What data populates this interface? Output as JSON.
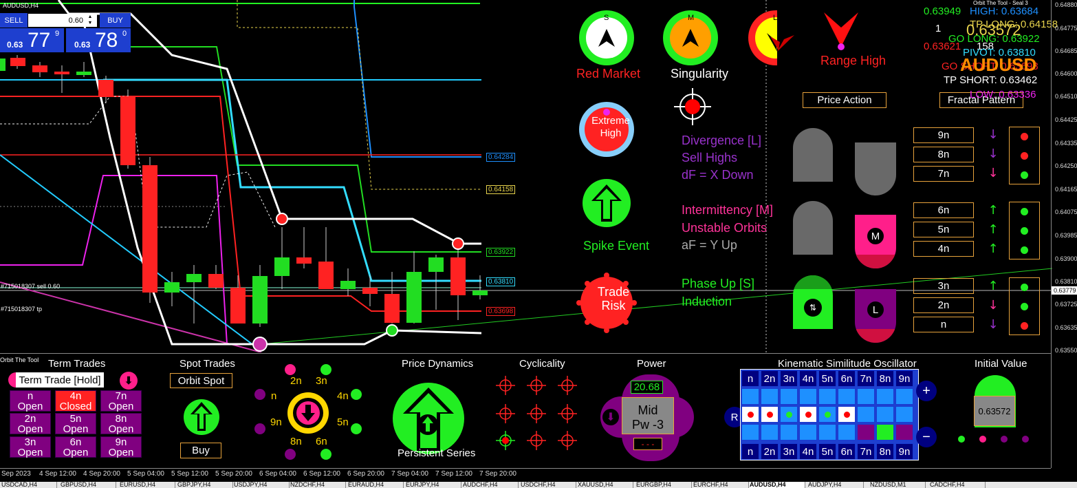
{
  "chart": {
    "symbol_tf": "AUDUSD,H4",
    "symbol_big": "AUDUSD",
    "orbit_label": "Orbit The Tool - Seal 3",
    "trade_label_sell": "#715018307 sell 0.60",
    "trade_label_tp": "#715018307 tp",
    "price_axis": [
      "0.64880",
      "0.64775",
      "0.64685",
      "0.64600",
      "0.64510",
      "0.64425",
      "0.64335",
      "0.64250",
      "0.64165",
      "0.64075",
      "0.63985",
      "0.63900",
      "0.63810",
      "0.63725",
      "0.63635",
      "0.63550"
    ],
    "current_price": "0.63779",
    "time_axis": [
      "Sep 2023",
      "4 Sep 12:00",
      "4 Sep 20:00",
      "5 Sep 04:00",
      "5 Sep 12:00",
      "5 Sep 20:00",
      "6 Sep 04:00",
      "6 Sep 12:00",
      "6 Sep 20:00",
      "7 Sep 04:00",
      "7 Sep 12:00",
      "7 Sep 20:00"
    ],
    "level_tags": {
      "l1": "0.64284",
      "l2": "0.64158",
      "l3": "0.63922",
      "l4": "0.63810",
      "l5": "0.63698"
    }
  },
  "trade_panel": {
    "sell_label": "SELL",
    "buy_label": "BUY",
    "lot_value": "0.60",
    "sell_prefix": "0.63",
    "sell_big": "77",
    "sell_sup": "9",
    "buy_prefix": "0.63",
    "buy_big": "78",
    "buy_sup": "0"
  },
  "info": {
    "v1": "0.63949",
    "high": "HIGH: 0.63684",
    "tp_long": "TP LONG: 0.64158",
    "one": "1",
    "big_price": "0.63572",
    "go_long": "GO LONG: 0.63922",
    "v2": "0.63621",
    "n158": "158",
    "pivot": "PIVOT: 0.63810",
    "go_short": "GO SHORT: 0.63698",
    "tp_short": "TP SHORT: 0.63462",
    "low": "LOW: 0.63336"
  },
  "indicators": {
    "red_market": "Red Market",
    "singularity": "Singularity",
    "range_high": "Range High",
    "s_letter": "S",
    "m_letter": "M",
    "l_letter": "L",
    "extreme_high": "Extreme High",
    "spike_event": "Spike Event",
    "trade_risk": "Trade Risk",
    "price_action": "Price Action",
    "fractal_pattern": "Fractal Pattern",
    "div1": "Divergence [L]",
    "div2": "Sell Highs",
    "div3": "dF = X Down",
    "int1": "Intermittency [M]",
    "int2": "Unstable Orbits",
    "int3": "aF = Y Up",
    "ph1": "Phase Up [S]",
    "ph2": "Induction",
    "m_icon": "M",
    "l_icon": "L",
    "nlabels": [
      "9n",
      "8n",
      "7n",
      "6n",
      "5n",
      "4n",
      "3n",
      "2n",
      "n"
    ]
  },
  "bottom": {
    "orbit_tool": "Orbit The Tool",
    "term_trades": "Term Trades",
    "term_trade_hold": "Term Trade [Hold]",
    "term_cells": [
      [
        "n",
        "Open"
      ],
      [
        "4n",
        "Closed"
      ],
      [
        "7n",
        "Open"
      ],
      [
        "2n",
        "Open"
      ],
      [
        "5n",
        "Open"
      ],
      [
        "8n",
        "Open"
      ],
      [
        "3n",
        "Open"
      ],
      [
        "6n",
        "Open"
      ],
      [
        "9n",
        "Open"
      ]
    ],
    "spot_trades": "Spot Trades",
    "orbit_spot": "Orbit Spot",
    "buy": "Buy",
    "ring_labels": {
      "n2": "2n",
      "n3": "3n",
      "n": "n",
      "n4": "4n",
      "n9": "9n",
      "n5": "5n",
      "n8": "8n",
      "n6": "6n"
    },
    "price_dynamics": "Price Dynamics",
    "persistent_series": "Persistent Series",
    "cyclicality": "Cyclicality",
    "power": "Power",
    "power_value": "20.68",
    "power_mid": "Mid",
    "power_pw": "Pw -3",
    "power_dashes": "- - -",
    "kso": "Kinematic Similitude Oscillator",
    "kso_labels": [
      "n",
      "2n",
      "3n",
      "4n",
      "5n",
      "6n",
      "7n",
      "8n",
      "9n"
    ],
    "r_label": "R",
    "plus": "+",
    "minus": "−",
    "initial_value": "Initial Value",
    "initial_value_num": "0.63572"
  },
  "tabs": [
    "USDCAD,H4",
    "GBPUSD,H4",
    "EURUSD,H4",
    "GBPJPY,H4",
    "USDJPY,H4",
    "NZDCHF,H4",
    "EURAUD,H4",
    "EURJPY,H4",
    "AUDCHF,H4",
    "USDCHF,H4",
    "XAUUSD,H4",
    "EURGBP,H4",
    "EURCHF,H4",
    "AUDUSD,H4",
    "AUDJPY,H4",
    "NZDUSD,M1",
    "CADCHF,H4"
  ]
}
